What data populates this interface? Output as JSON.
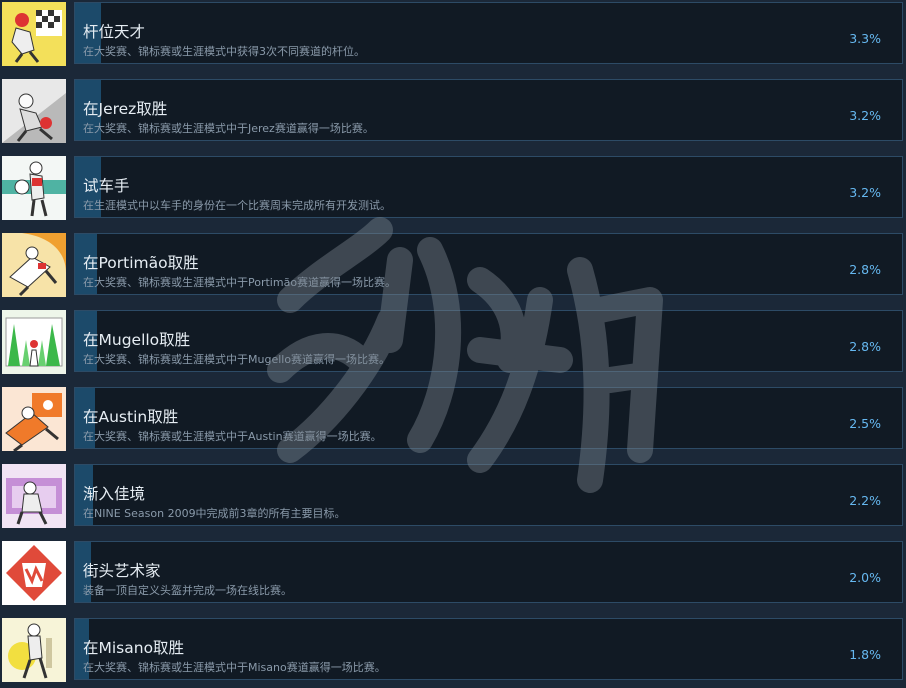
{
  "achievements": [
    {
      "title": "杆位天才",
      "desc": "在大奖赛、锦标赛或生涯模式中获得3次不同赛道的杆位。",
      "percent": "3.3%",
      "icon": "pole-position-rider-icon",
      "bg": "#f3e05a"
    },
    {
      "title": "在Jerez取胜",
      "desc": "在大奖赛、锦标赛或生涯模式中于Jerez赛道赢得一场比赛。",
      "percent": "3.2%",
      "icon": "jerez-rider-icon",
      "bg": "#e8e8e8"
    },
    {
      "title": "试车手",
      "desc": "在生涯模式中以车手的身份在一个比赛周末完成所有开发测试。",
      "percent": "3.2%",
      "icon": "test-rider-icon",
      "bg": "#f3f7f5"
    },
    {
      "title": "在Portimão取胜",
      "desc": "在大奖赛、锦标赛或生涯模式中于Portimão赛道赢得一场比赛。",
      "percent": "2.8%",
      "icon": "portimao-rider-icon",
      "bg": "#f7e3a8"
    },
    {
      "title": "在Mugello取胜",
      "desc": "在大奖赛、锦标赛或生涯模式中于Mugello赛道赢得一场比赛。",
      "percent": "2.8%",
      "icon": "mugello-rider-icon",
      "bg": "#eef6ea"
    },
    {
      "title": "在Austin取胜",
      "desc": "在大奖赛、锦标赛或生涯模式中于Austin赛道赢得一场比赛。",
      "percent": "2.5%",
      "icon": "austin-rider-icon",
      "bg": "#fbe6d4"
    },
    {
      "title": "渐入佳境",
      "desc": "在NINE Season 2009中完成前3章的所有主要目标。",
      "percent": "2.2%",
      "icon": "season-rider-icon",
      "bg": "#f1e4f4"
    },
    {
      "title": "街头艺术家",
      "desc": "装备一顶自定义头盔并完成一场在线比赛。",
      "percent": "2.0%",
      "icon": "street-artist-icon",
      "bg": "#ffffff"
    },
    {
      "title": "在Misano取胜",
      "desc": "在大奖赛、锦标赛或生涯模式中于Misano赛道赢得一场比赛。",
      "percent": "1.8%",
      "icon": "misano-rider-icon",
      "bg": "#f7f4d8"
    }
  ],
  "colors": {
    "background": "#1b2838",
    "panel": "#111a24",
    "border": "#2d4b66",
    "bar": "#1c4a6a",
    "title": "#e6edf3",
    "desc": "#8a9aaa",
    "percent": "#66b8f0"
  }
}
